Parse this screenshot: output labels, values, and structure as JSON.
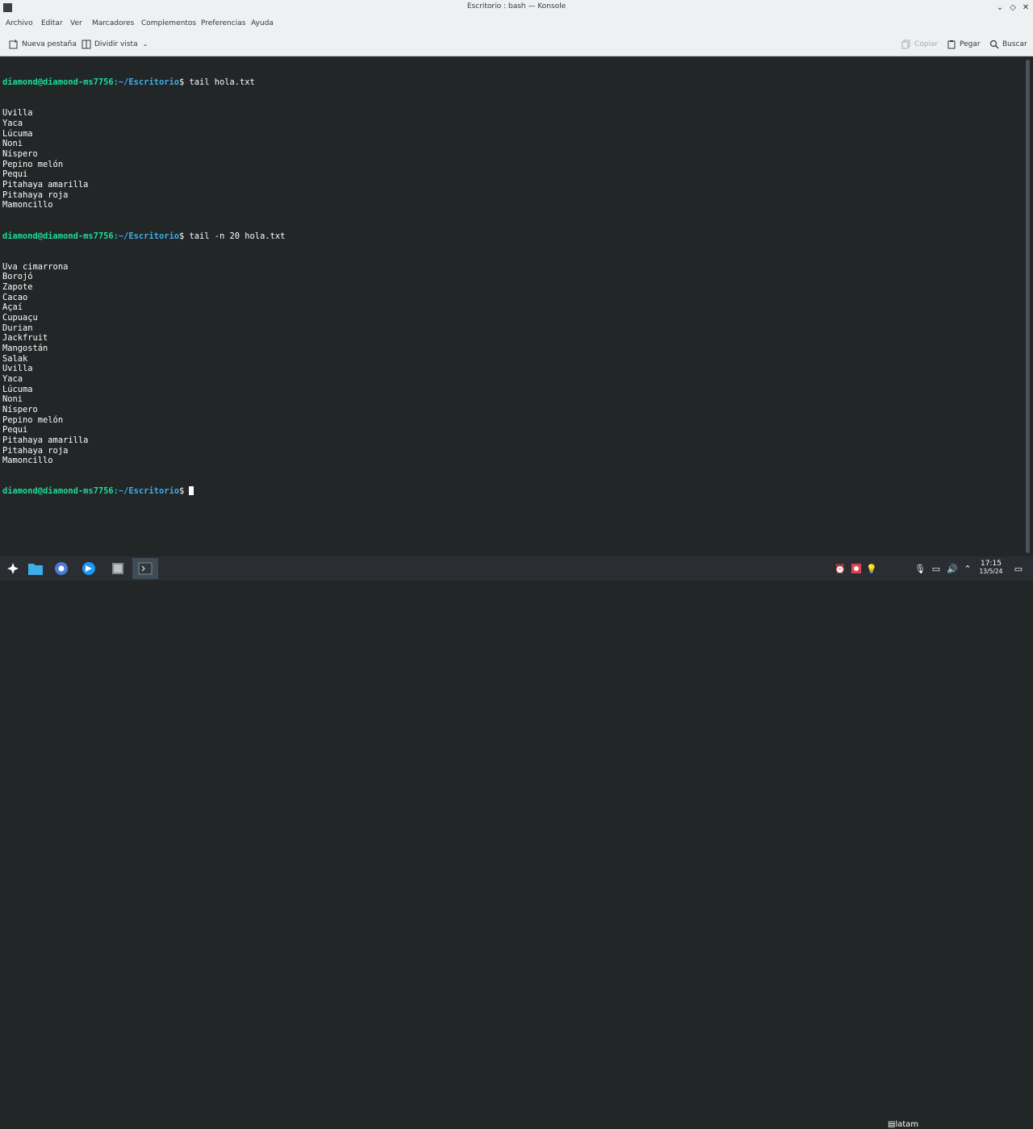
{
  "window": {
    "title": "Escritorio : bash — Konsole"
  },
  "menubar": {
    "items": [
      "Archivo",
      "Editar",
      "Ver",
      "Marcadores",
      "Complementos",
      "Preferencias",
      "Ayuda"
    ]
  },
  "toolbar": {
    "new_tab": "Nueva pestaña",
    "split_view": "Dividir vista",
    "copy": "Copiar",
    "paste": "Pegar",
    "find": "Buscar"
  },
  "terminal": {
    "prompt_user": "diamond@diamond-ms7756",
    "prompt_path": ":~/Escritorio",
    "prompt_symbol": "$ ",
    "cmd1": "tail hola.txt",
    "out1": [
      "Uvilla",
      "Yaca",
      "Lúcuma",
      "Noni",
      "Níspero",
      "Pepino melón",
      "Pequi",
      "Pitahaya amarilla",
      "Pitahaya roja",
      "Mamoncillo"
    ],
    "cmd2": "tail -n 20 hola.txt",
    "out2": [
      "Uva cimarrona",
      "Borojó",
      "Zapote",
      "Cacao",
      "Açaí",
      "Cupuaçu",
      "Durian",
      "Jackfruit",
      "Mangostán",
      "Salak",
      "Uvilla",
      "Yaca",
      "Lúcuma",
      "Noni",
      "Níspero",
      "Pepino melón",
      "Pequi",
      "Pitahaya amarilla",
      "Pitahaya roja",
      "Mamoncillo"
    ]
  },
  "taskbar": {
    "keyboard_layout": "latam",
    "clock_time": "17:15",
    "clock_date": "13/5/24"
  },
  "colors": {
    "prompt_user": "#1cdc9a",
    "prompt_path": "#3daee9",
    "terminal_bg": "#232627",
    "chrome_bg": "#eff0f1"
  }
}
